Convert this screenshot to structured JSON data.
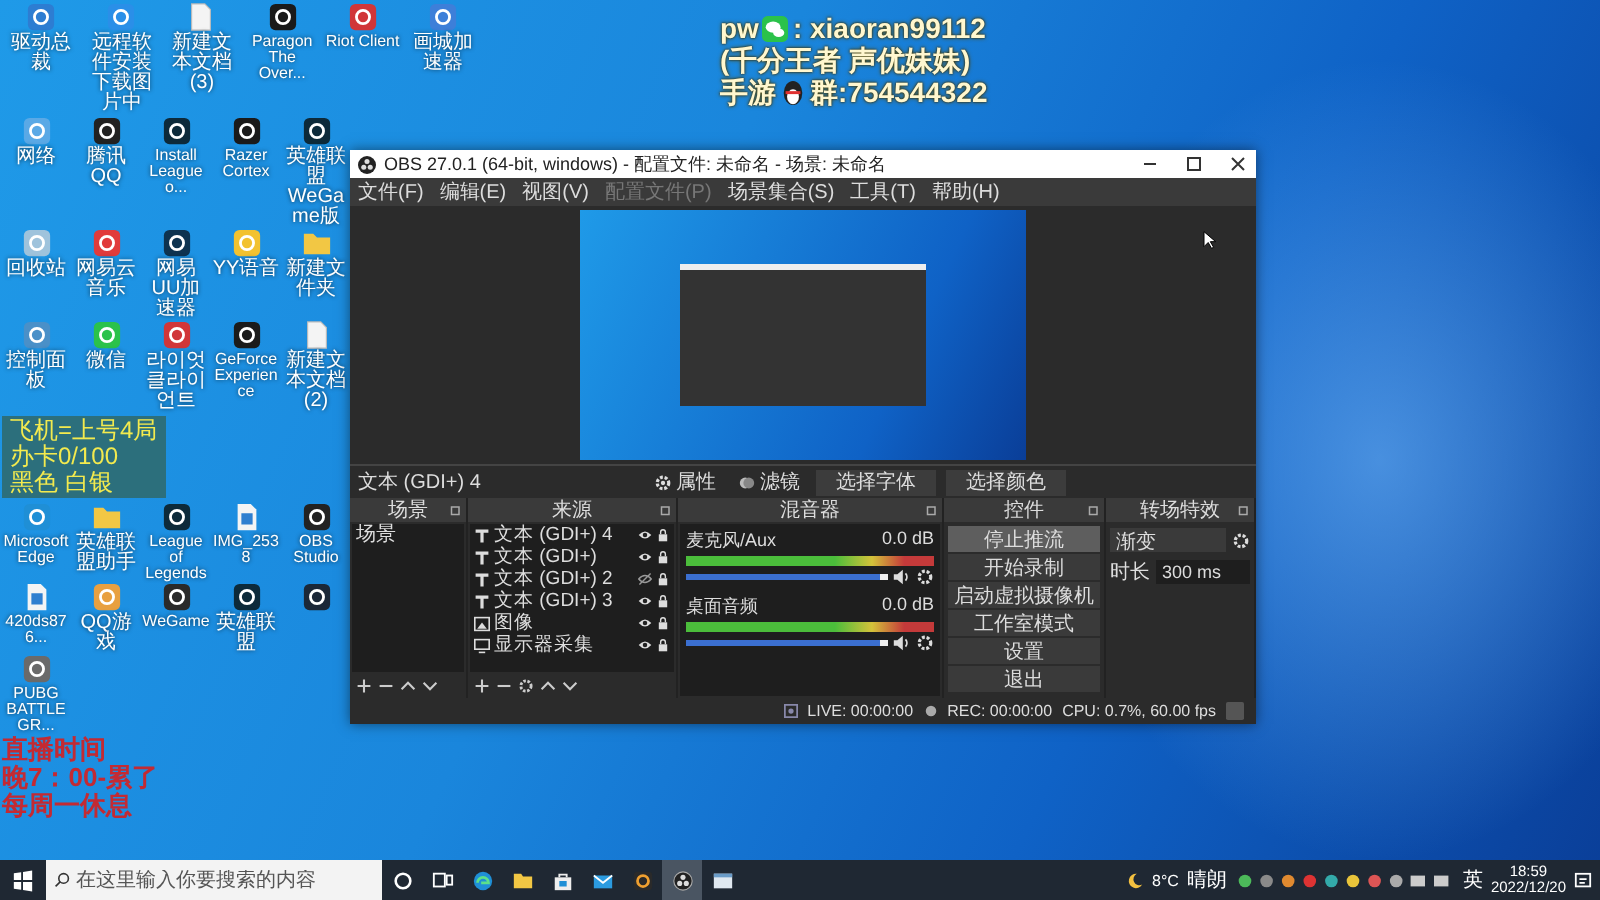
{
  "contact_overlay": {
    "lines": [
      {
        "parts": [
          {
            "kind": "text",
            "text": "pw"
          },
          {
            "kind": "wechat"
          },
          {
            "kind": "text",
            "text": ": xiaoran99112"
          }
        ]
      },
      {
        "parts": [
          {
            "kind": "text",
            "text": "(千分王者 声优妹妹)"
          }
        ]
      },
      {
        "parts": [
          {
            "kind": "text",
            "text": "手游"
          },
          {
            "kind": "penguin"
          },
          {
            "kind": "text",
            "text": "群:754544322"
          }
        ]
      }
    ]
  },
  "desktop": {
    "top_row": [
      {
        "label": "驱动总裁",
        "kind": "app",
        "color": "#2d7dd2"
      },
      {
        "label": "远程软件安装下载图片中",
        "kind": "app",
        "color": "#2a8fe8"
      },
      {
        "label": "新建文本文档 (3)",
        "kind": "file"
      },
      {
        "label": "Paragon The Over...",
        "kind": "app",
        "color": "#1a1a1a"
      },
      {
        "label": "Riot Client",
        "kind": "app",
        "color": "#d13639"
      },
      {
        "label": "画城加速器",
        "kind": "app",
        "color": "#3d7fd9"
      }
    ],
    "group_1": [
      {
        "label": "网络",
        "kind": "app",
        "color": "#5aa9e6"
      },
      {
        "label": "腾讯QQ",
        "kind": "app",
        "color": "#222222"
      },
      {
        "label": "Install League o...",
        "kind": "app",
        "color": "#0d2a3a"
      },
      {
        "label": "Razer Cortex",
        "kind": "app",
        "color": "#1a1a1a"
      },
      {
        "label": "英雄联盟WeGame版",
        "kind": "app",
        "color": "#0d2a3a"
      },
      {
        "label": "回收站",
        "kind": "app",
        "color": "#9fc3dc"
      },
      {
        "label": "网易云音乐",
        "kind": "app",
        "color": "#e13b3b"
      },
      {
        "label": "网易UU加速器",
        "kind": "app",
        "color": "#0e3350"
      },
      {
        "label": "YY语音",
        "kind": "app",
        "color": "#f2c230"
      },
      {
        "label": "新建文件夹",
        "kind": "folder"
      },
      {
        "label": "控制面板",
        "kind": "app",
        "color": "#4a90c8"
      },
      {
        "label": "微信",
        "kind": "app",
        "color": "#2bc24a"
      },
      {
        "label": "라이엇 클라이언트",
        "kind": "app",
        "color": "#d13639"
      },
      {
        "label": "GeForce Experience",
        "kind": "app",
        "color": "#1b1b1b"
      },
      {
        "label": "新建文本文档 (2)",
        "kind": "file"
      }
    ],
    "info_box": {
      "lines": [
        "飞机=上号4局",
        "办卡0/100",
        "黑色  白银"
      ]
    },
    "group_2": [
      {
        "label": "Microsoft Edge",
        "kind": "app",
        "color": "#1f8fd6"
      },
      {
        "label": "英雄联盟助手",
        "kind": "folder"
      },
      {
        "label": "League of Legends",
        "kind": "app",
        "color": "#0d2a3a"
      },
      {
        "label": "IMG_2538",
        "kind": "image"
      },
      {
        "label": "OBS Studio",
        "kind": "app",
        "color": "#222222"
      },
      {
        "label": "420ds876...",
        "kind": "image"
      },
      {
        "label": "QQ游戏",
        "kind": "app",
        "color": "#e8a040"
      },
      {
        "label": "WeGame",
        "kind": "app",
        "color": "#2a2a2a"
      },
      {
        "label": "英雄联盟",
        "kind": "app",
        "color": "#0d2a3a"
      },
      {
        "kind": "app",
        "color": "#1b2838"
      },
      {
        "label": "PUBG BATTLEGR...",
        "kind": "app",
        "color": "#6a6a6a"
      }
    ],
    "schedule": {
      "lines": [
        "直播时间",
        "晚7：00-累了",
        "每周一休息"
      ]
    }
  },
  "obs": {
    "title": "OBS 27.0.1 (64-bit, windows) - 配置文件: 未命名 - 场景: 未命名",
    "menu": [
      {
        "label": "文件(F)",
        "disabled": false
      },
      {
        "label": "编辑(E)",
        "disabled": false
      },
      {
        "label": "视图(V)",
        "disabled": false
      },
      {
        "label": "配置文件(P)",
        "disabled": true
      },
      {
        "label": "场景集合(S)",
        "disabled": false
      },
      {
        "label": "工具(T)",
        "disabled": false
      },
      {
        "label": "帮助(H)",
        "disabled": false
      }
    ],
    "source_bar": {
      "name": "文本 (GDI+) 4",
      "buttons": [
        {
          "label": "属性",
          "kind": "gear"
        },
        {
          "label": "滤镜",
          "kind": "filter"
        },
        {
          "label": "选择字体",
          "kind": "plain"
        },
        {
          "label": "选择颜色",
          "kind": "plain"
        }
      ]
    },
    "scenes": {
      "title": "场景",
      "items": [
        {
          "label": "场景",
          "selected": false
        }
      ]
    },
    "sources": {
      "title": "来源",
      "items": [
        {
          "label": "文本 (GDI+) 4",
          "kind": "text",
          "visible": true
        },
        {
          "label": "文本 (GDI+)",
          "kind": "text",
          "visible": true
        },
        {
          "label": "文本 (GDI+) 2",
          "kind": "text",
          "visible": false
        },
        {
          "label": "文本 (GDI+) 3",
          "kind": "text",
          "visible": true
        },
        {
          "label": "图像",
          "kind": "image",
          "visible": true
        },
        {
          "label": "显示器采集",
          "kind": "display",
          "visible": true
        }
      ]
    },
    "mixer": {
      "title": "混音器",
      "channels": [
        {
          "name": "麦克风/Aux",
          "reading": "0.0 dB",
          "level": 0.97
        },
        {
          "name": "桌面音频",
          "reading": "0.0 dB",
          "level": 0.97
        }
      ]
    },
    "controls": {
      "title": "控件",
      "buttons": [
        {
          "label": "停止推流",
          "on": true
        },
        {
          "label": "开始录制",
          "on": false
        },
        {
          "label": "启动虚拟摄像机",
          "on": false
        },
        {
          "label": "工作室模式",
          "on": false
        },
        {
          "label": "设置",
          "on": false
        },
        {
          "label": "退出",
          "on": false
        }
      ]
    },
    "transitions": {
      "title": "转场特效",
      "type": "渐变",
      "duration_label": "时长",
      "duration": "300 ms"
    },
    "status_bar": {
      "live": "LIVE: 00:00:00",
      "rec": "REC: 00:00:00",
      "cpu": "CPU: 0.7%, 60.00 fps"
    }
  },
  "taskbar": {
    "search": {
      "placeholder": "在这里输入你要搜索的内容"
    },
    "apps": [
      {
        "kind": "circle",
        "active": false
      },
      {
        "kind": "taskview",
        "active": false
      },
      {
        "kind": "globe",
        "active": false
      },
      {
        "kind": "folder",
        "active": false
      },
      {
        "kind": "bag",
        "active": false
      },
      {
        "kind": "mail",
        "active": false
      },
      {
        "kind": "ring",
        "active": false
      },
      {
        "kind": "obs",
        "active": true
      },
      {
        "kind": "window",
        "active": false
      }
    ],
    "temperature": "8°C",
    "weather": "晴朗",
    "input_method": "英",
    "time": "18:59",
    "date": "2022/12/20"
  }
}
